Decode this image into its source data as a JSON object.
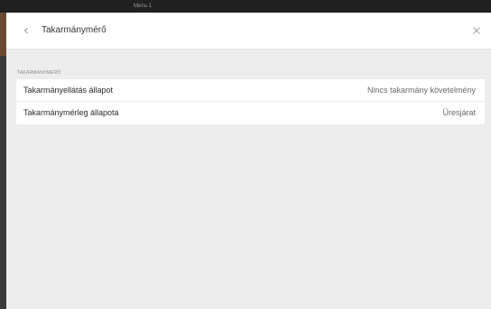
{
  "backdrop": {
    "top_text": "Menu 1"
  },
  "panel": {
    "title": "Takarmánymérő",
    "back_icon": "chevron-left-icon",
    "close_icon": "close-icon",
    "section_label": "TAKARMÁNYMÉRŐ",
    "rows": [
      {
        "label": "Takarmányellátás állapot",
        "value": "Nincs takarmány követelmény"
      },
      {
        "label": "Takarmánymérleg állapota",
        "value": "Üresjárat"
      }
    ]
  },
  "colors": {
    "panel_background": "#ededed",
    "header_background": "#ffffff",
    "backdrop": "#202020",
    "accent": "#6a4a33"
  }
}
